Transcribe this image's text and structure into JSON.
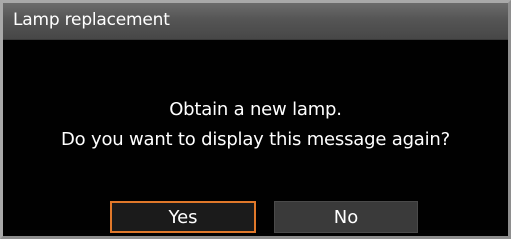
{
  "dialog": {
    "title": "Lamp replacement",
    "message_line1": "Obtain a new lamp.",
    "message_line2": "Do you want to display this message again?",
    "buttons": {
      "yes_label": "Yes",
      "no_label": "No"
    },
    "focused_button": "Yes"
  },
  "colors": {
    "background": "#010101",
    "title_bar": "#555555",
    "focus_border": "#e0782a",
    "text": "#ffffff",
    "button_idle": "#3a3a3a"
  }
}
